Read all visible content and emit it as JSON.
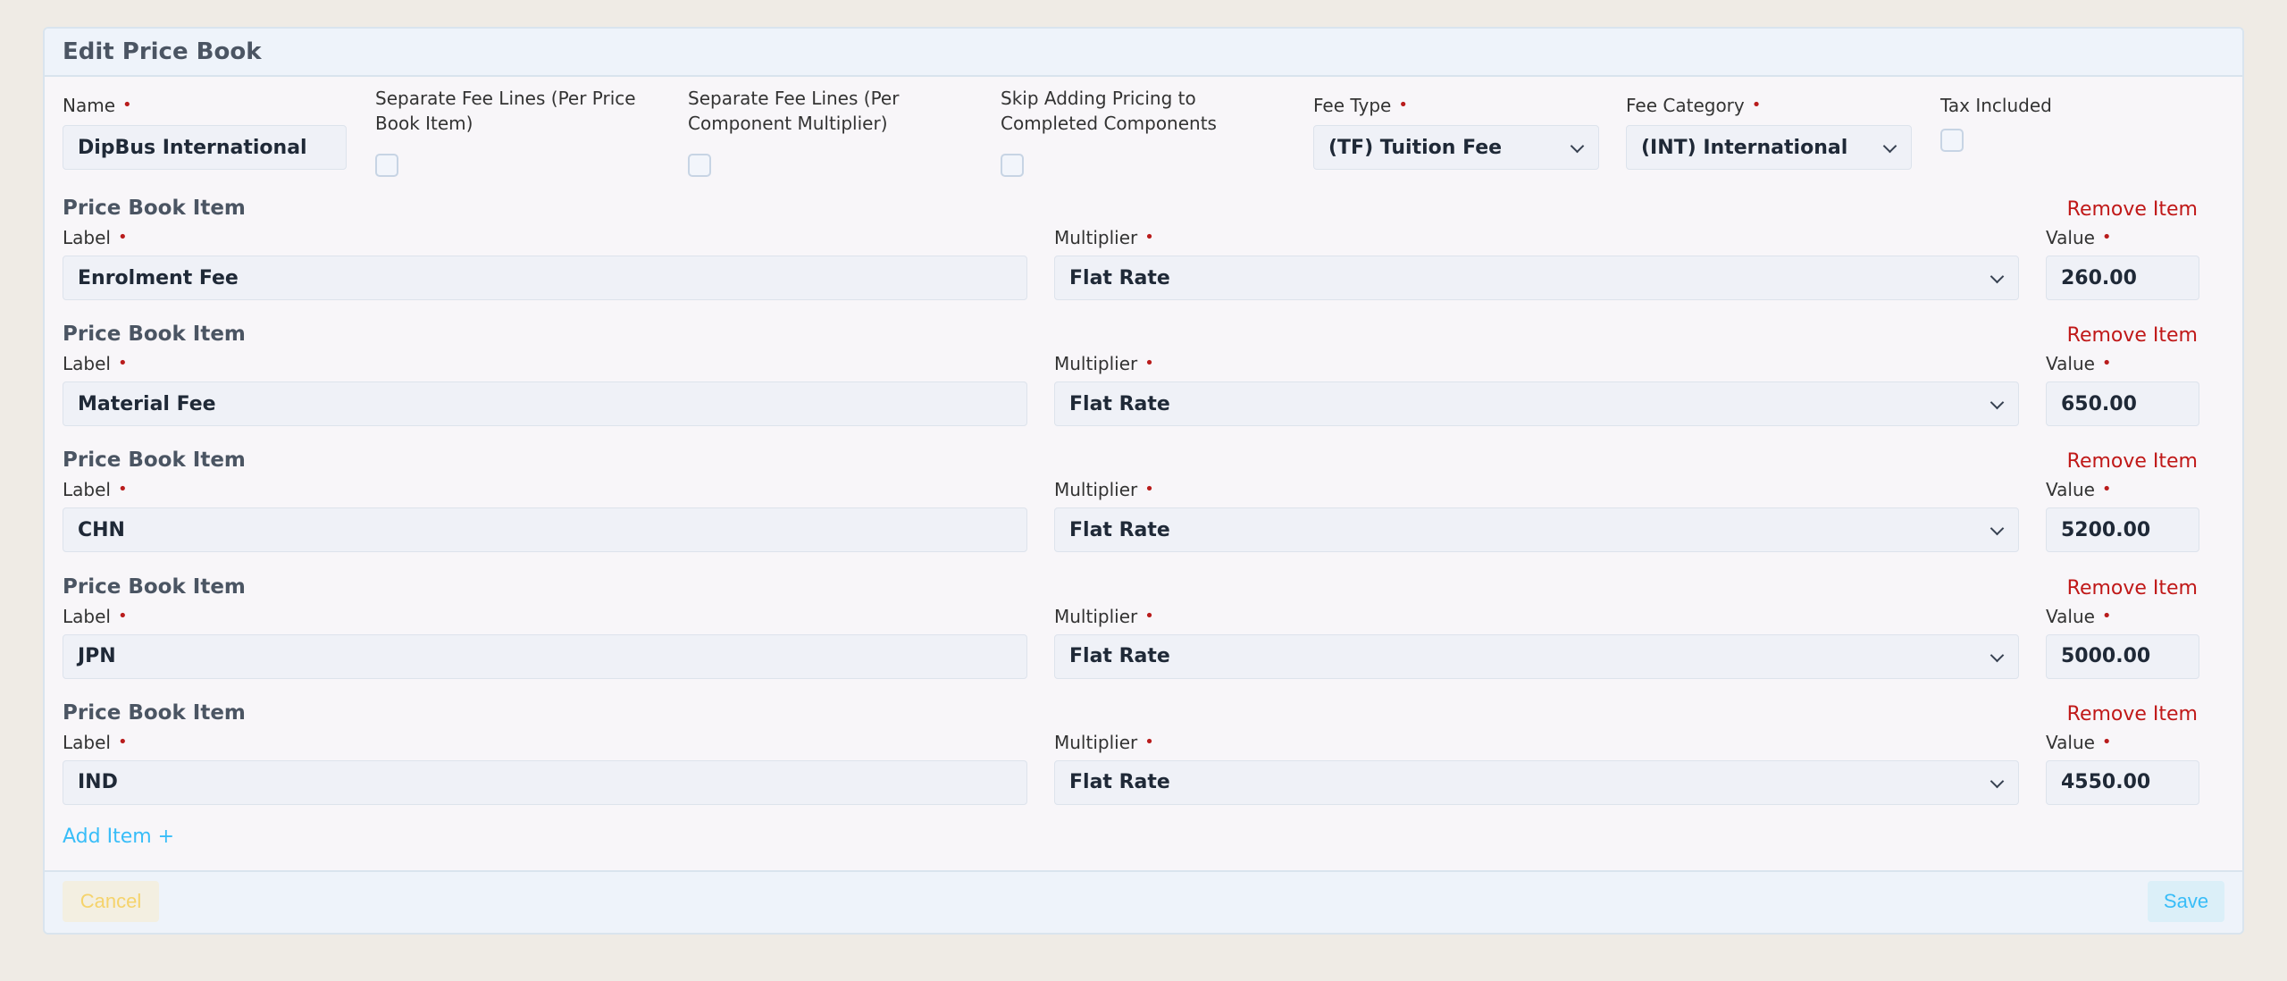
{
  "form": {
    "title": "Edit Price Book",
    "name": {
      "label": "Name",
      "value": "DipBus International"
    },
    "separate_per_item": {
      "label": "Separate Fee Lines (Per Price Book Item)"
    },
    "separate_per_component": {
      "label": "Separate Fee Lines (Per Component Multiplier)"
    },
    "skip_completed": {
      "label": "Skip Adding Pricing to Completed Components"
    },
    "fee_type": {
      "label": "Fee Type",
      "value": "(TF) Tuition Fee"
    },
    "fee_category": {
      "label": "Fee Category",
      "value": "(INT) International"
    },
    "tax_included": {
      "label": "Tax Included"
    },
    "item_section_title": "Price Book Item",
    "remove_label": "Remove Item",
    "label_field_label": "Label",
    "multiplier_field_label": "Multiplier",
    "value_field_label": "Value",
    "items": [
      {
        "label": "Enrolment Fee",
        "multiplier": "Flat Rate",
        "value": "260.00"
      },
      {
        "label": "Material Fee",
        "multiplier": "Flat Rate",
        "value": "650.00"
      },
      {
        "label": "CHN",
        "multiplier": "Flat Rate",
        "value": "5200.00"
      },
      {
        "label": "JPN",
        "multiplier": "Flat Rate",
        "value": "5000.00"
      },
      {
        "label": "IND",
        "multiplier": "Flat Rate",
        "value": "4550.00"
      }
    ],
    "add_item_label": "Add Item +",
    "cancel_label": "Cancel",
    "save_label": "Save"
  }
}
